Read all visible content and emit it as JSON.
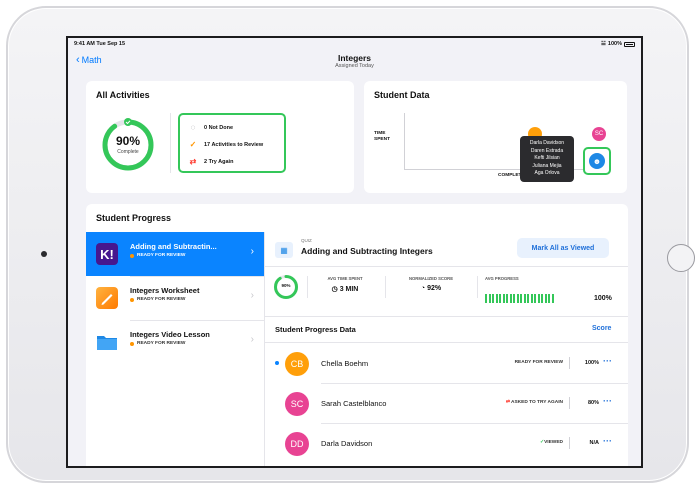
{
  "status_bar": {
    "time": "9:41 AM  Tue Sep 15",
    "battery": "100%"
  },
  "nav": {
    "back_label": "Math",
    "title": "Integers",
    "subtitle": "Assigned Today"
  },
  "all_activities": {
    "title": "All Activities",
    "percent_label": "90%",
    "percent_value": 0.9,
    "complete_label": "Complete",
    "stats": [
      {
        "icon": "not-done-icon",
        "label": "0 Not Done"
      },
      {
        "icon": "check-icon",
        "label": "17 Activities to Review"
      },
      {
        "icon": "try-again-icon",
        "label": "2 Try Again"
      }
    ]
  },
  "student_data": {
    "title": "Student Data",
    "y_label_1": "TIME",
    "y_label_2": "SPENT",
    "x_label": "COMPLETI",
    "sc_initials": "SC",
    "tooltip_names": [
      "Darla Davidson",
      "Daren Estrada",
      "Kefti Jilsian",
      "Juliana Mejia",
      "Aga Orlova"
    ]
  },
  "student_progress": {
    "title": "Student Progress",
    "activities": [
      {
        "title": "Adding and Subtractin...",
        "status": "READY FOR REVIEW",
        "icon": "kahoot-icon",
        "active": true
      },
      {
        "title": "Integers Worksheet",
        "status": "READY FOR REVIEW",
        "icon": "pages-icon",
        "active": false
      },
      {
        "title": "Integers Video Lesson",
        "status": "READY FOR REVIEW",
        "icon": "folder-icon",
        "active": false
      }
    ],
    "detail": {
      "type_label": "QUIZ",
      "title": "Adding and Subtracting Integers",
      "mark_all_label": "Mark All as Viewed",
      "ring_label": "90%",
      "metrics": [
        {
          "header": "AVG TIME SPENT",
          "value": "3 MIN",
          "icon": "clock-icon"
        },
        {
          "header": "NORMALIZED SCORE",
          "value": "92%",
          "icon": "gauge-icon"
        },
        {
          "header": "AVG PROGRESS",
          "value": "100%"
        }
      ],
      "avg_progress_value": 1.0,
      "section_title": "Student Progress Data",
      "score_label": "Score",
      "rows": [
        {
          "initials": "CB",
          "name": "Chella Boehm",
          "status": "READY FOR REVIEW",
          "status_type": "ready",
          "score": "100%",
          "color": "#ff9f0a",
          "unread": true
        },
        {
          "initials": "SC",
          "name": "Sarah Castelblanco",
          "status": "ASKED TO TRY AGAIN",
          "status_type": "retry",
          "score": "80%",
          "color": "#e84393",
          "unread": false
        },
        {
          "initials": "DD",
          "name": "Darla Davidson",
          "status": "VIEWED",
          "status_type": "viewed",
          "score": "N/A",
          "color": "#e84393",
          "unread": false
        }
      ]
    }
  },
  "colors": {
    "accent": "#0a84ff",
    "green": "#34c759",
    "orange": "#ff9500",
    "pink": "#e84393"
  }
}
